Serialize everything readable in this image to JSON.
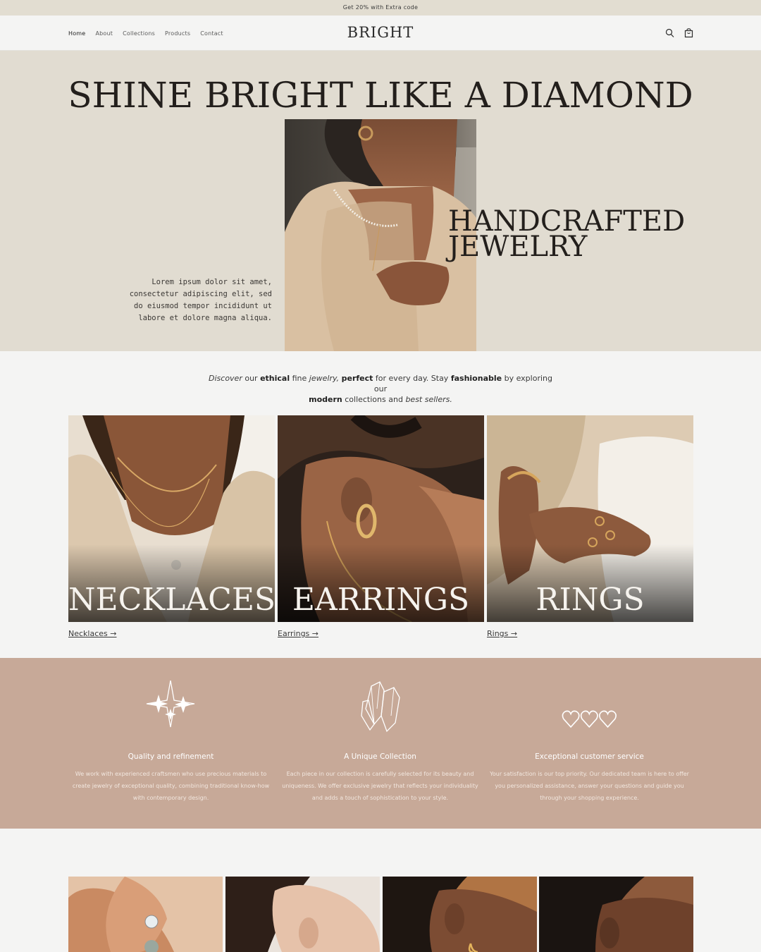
{
  "announcement": "Get 20% with Extra code",
  "header": {
    "nav": [
      "Home",
      "About",
      "Collections",
      "Products",
      "Contact"
    ],
    "logo": "BRIGHT",
    "icons": [
      "search-icon",
      "cart-icon"
    ]
  },
  "hero": {
    "title": "SHINE BRIGHT LIKE A DIAMOND",
    "subtitle_line1": "HANDCRAFTED",
    "subtitle_line2": "JEWELRY",
    "text": "Lorem ipsum dolor sit amet, consectetur adipiscing elit, sed do eiusmod tempor incididunt ut labore et dolore magna aliqua."
  },
  "intro": {
    "w1": "Discover",
    "w2": " our ",
    "w3": "ethical",
    "w4": " fine ",
    "w5": "jewelry,",
    "w6": " ",
    "w7": "perfect",
    "w8": " for every day. Stay ",
    "w9": "fashionable",
    "w10": " by exploring our",
    "w11": "modern",
    "w12": " collections and ",
    "w13": "best sellers."
  },
  "categories": [
    {
      "overlay": "NECKLACES",
      "link": "Necklaces →"
    },
    {
      "overlay": "EARRINGS",
      "link": "Earrings →"
    },
    {
      "overlay": "RINGS",
      "link": "Rings →"
    }
  ],
  "features": [
    {
      "icon": "sparkle-icon",
      "title": "Quality and refinement",
      "desc": "We work with experienced craftsmen who use precious materials to create jewelry of exceptional quality, combining traditional know-how with contemporary design."
    },
    {
      "icon": "crystal-icon",
      "title": "A Unique Collection",
      "desc": "Each piece in our collection is carefully selected for its beauty and uniqueness. We offer exclusive jewelry that reflects your individuality and adds a touch of sophistication to your style."
    },
    {
      "icon": "hearts-icon",
      "title": "Exceptional customer service",
      "desc": "Your satisfaction is our top priority. Our dedicated team is here to offer you personalized assistance, answer your questions and guide you through your shopping experience."
    }
  ],
  "colors": {
    "announcement_bg": "#e2ddd1",
    "hero_bg": "#e1dcd1",
    "features_bg": "#c7a998",
    "page_bg": "#f4f4f3"
  }
}
